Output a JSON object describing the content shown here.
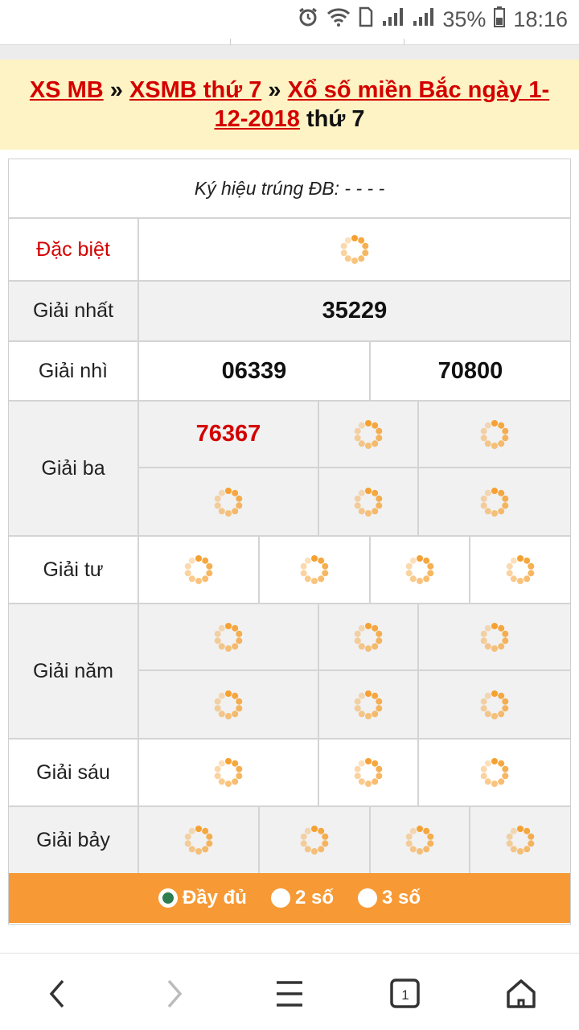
{
  "status": {
    "battery": "35%",
    "time": "18:16"
  },
  "breadcrumb": {
    "link1": "XS MB",
    "sep1": "»",
    "link2": "XSMB thứ 7",
    "sep2": "»",
    "link3": "Xổ số miền Bắc ngày 1-12-2018",
    "suffix": "thứ 7"
  },
  "kyhieu": "Ký hiệu trúng ĐB: - - - -",
  "prizes": {
    "dac_biet": "Đặc biệt",
    "nhat": {
      "label": "Giải nhất",
      "value": "35229"
    },
    "nhi": {
      "label": "Giải nhì",
      "values": [
        "06339",
        "70800"
      ]
    },
    "ba": {
      "label": "Giải ba",
      "first": "76367"
    },
    "tu": "Giải tư",
    "nam": "Giải năm",
    "sau": "Giải sáu",
    "bay": "Giải bảy"
  },
  "footer": {
    "opt_full": "Đầy đủ",
    "opt_2": "2 số",
    "opt_3": "3 số"
  },
  "colors": {
    "accent": "#d40000",
    "footer": "#f79a35",
    "header_bg": "#fdf3c4"
  }
}
